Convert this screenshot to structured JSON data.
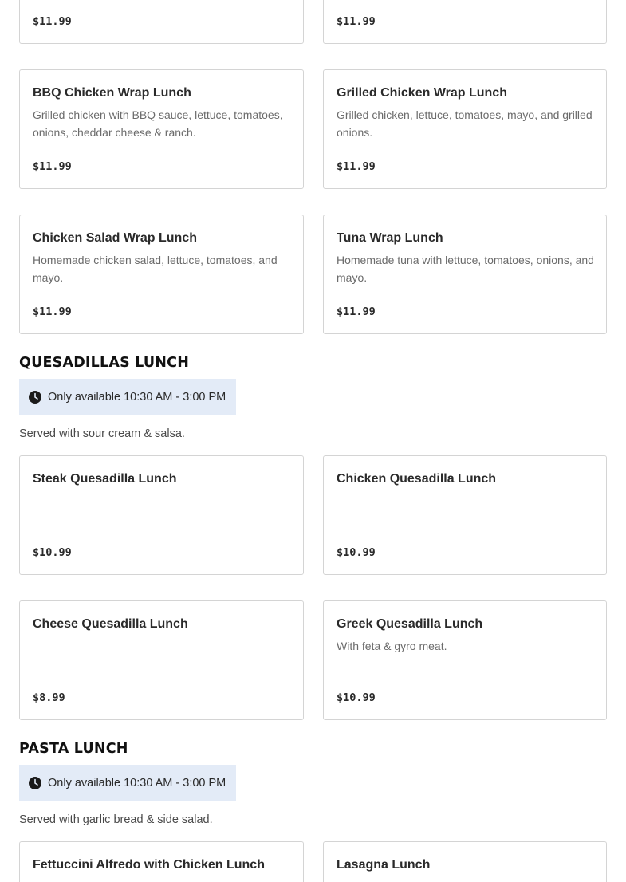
{
  "top_cards": [
    {
      "price": "$11.99"
    },
    {
      "price": "$11.99"
    }
  ],
  "wraps": [
    {
      "name": "BBQ Chicken Wrap Lunch",
      "description": "Grilled chicken with BBQ sauce, lettuce, tomatoes, onions, cheddar cheese & ranch.",
      "price": "$11.99"
    },
    {
      "name": "Grilled Chicken Wrap Lunch",
      "description": "Grilled chicken, lettuce, tomatoes, mayo, and grilled onions.",
      "price": "$11.99"
    },
    {
      "name": "Chicken Salad Wrap Lunch",
      "description": "Homemade chicken salad, lettuce, tomatoes, and mayo.",
      "price": "$11.99"
    },
    {
      "name": "Tuna Wrap Lunch",
      "description": "Homemade tuna with lettuce, tomatoes, onions, and mayo.",
      "price": "$11.99"
    }
  ],
  "quesadillas": {
    "title": "QUESADILLAS LUNCH",
    "availability": "Only available 10:30 AM - 3:00 PM",
    "note": "Served with sour cream & salsa.",
    "items": [
      {
        "name": "Steak Quesadilla Lunch",
        "description": "",
        "price": "$10.99"
      },
      {
        "name": "Chicken Quesadilla Lunch",
        "description": "",
        "price": "$10.99"
      },
      {
        "name": "Cheese Quesadilla Lunch",
        "description": "",
        "price": "$8.99"
      },
      {
        "name": "Greek Quesadilla Lunch",
        "description": "With feta & gyro meat.",
        "price": "$10.99"
      }
    ]
  },
  "pasta": {
    "title": "PASTA LUNCH",
    "availability": "Only available 10:30 AM - 3:00 PM",
    "note": "Served with garlic bread & side salad.",
    "items": [
      {
        "name": "Fettuccini Alfredo with Chicken Lunch"
      },
      {
        "name": "Lasagna Lunch"
      }
    ]
  },
  "icons": {
    "availability": "clock-icon"
  },
  "colors": {
    "availability_bg": "#e3ebf7",
    "card_border": "#d4d4d4"
  }
}
